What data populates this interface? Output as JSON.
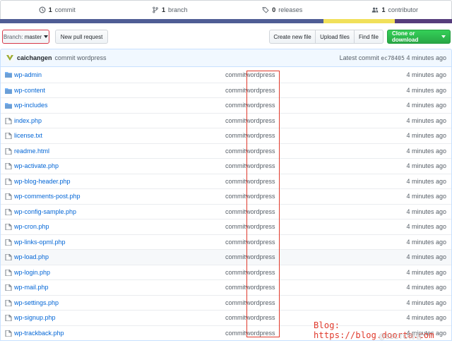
{
  "stats": {
    "commits_count": "1",
    "commits_label": "commit",
    "branches_count": "1",
    "branches_label": "branch",
    "releases_count": "0",
    "releases_label": "releases",
    "contributors_count": "1",
    "contributors_label": "contributor"
  },
  "language_bar_colors": [
    "#4f5d95",
    "#f1e05a",
    "#563d7c"
  ],
  "toolbar": {
    "branch_prefix": "Branch:",
    "branch_name": "master",
    "new_pull_request": "New pull request",
    "create_new_file": "Create new file",
    "upload_files": "Upload files",
    "find_file": "Find file",
    "clone_or_download": "Clone or download"
  },
  "commit_tease": {
    "author": "caichangen",
    "message": "commit wordpress",
    "latest_label": "Latest commit",
    "sha": "ec78405",
    "age": "4 minutes ago"
  },
  "files": [
    {
      "name": "wp-admin",
      "type": "dir",
      "message_a": "commit",
      "message_b": "wordpress",
      "age": "4 minutes ago"
    },
    {
      "name": "wp-content",
      "type": "dir",
      "message_a": "commit",
      "message_b": "wordpress",
      "age": "4 minutes ago"
    },
    {
      "name": "wp-includes",
      "type": "dir",
      "message_a": "commit",
      "message_b": "wordpress",
      "age": "4 minutes ago"
    },
    {
      "name": "index.php",
      "type": "file",
      "message_a": "commit",
      "message_b": "wordpress",
      "age": "4 minutes ago"
    },
    {
      "name": "license.txt",
      "type": "file",
      "message_a": "commit",
      "message_b": "wordpress",
      "age": "4 minutes ago"
    },
    {
      "name": "readme.html",
      "type": "file",
      "message_a": "commit",
      "message_b": "wordpress",
      "age": "4 minutes ago"
    },
    {
      "name": "wp-activate.php",
      "type": "file",
      "message_a": "commit",
      "message_b": "wordpress",
      "age": "4 minutes ago"
    },
    {
      "name": "wp-blog-header.php",
      "type": "file",
      "message_a": "commit",
      "message_b": "wordpress",
      "age": "4 minutes ago"
    },
    {
      "name": "wp-comments-post.php",
      "type": "file",
      "message_a": "commit",
      "message_b": "wordpress",
      "age": "4 minutes ago"
    },
    {
      "name": "wp-config-sample.php",
      "type": "file",
      "message_a": "commit",
      "message_b": "wordpress",
      "age": "4 minutes ago"
    },
    {
      "name": "wp-cron.php",
      "type": "file",
      "message_a": "commit",
      "message_b": "wordpress",
      "age": "4 minutes ago"
    },
    {
      "name": "wp-links-opml.php",
      "type": "file",
      "message_a": "commit",
      "message_b": "wordpress",
      "age": "4 minutes ago"
    },
    {
      "name": "wp-load.php",
      "type": "file",
      "message_a": "commit",
      "message_b": "wordpress",
      "age": "4 minutes ago"
    },
    {
      "name": "wp-login.php",
      "type": "file",
      "message_a": "commit",
      "message_b": "wordpress",
      "age": "4 minutes ago"
    },
    {
      "name": "wp-mail.php",
      "type": "file",
      "message_a": "commit",
      "message_b": "wordpress",
      "age": "4 minutes ago"
    },
    {
      "name": "wp-settings.php",
      "type": "file",
      "message_a": "commit",
      "message_b": "wordpress",
      "age": "4 minutes ago"
    },
    {
      "name": "wp-signup.php",
      "type": "file",
      "message_a": "commit",
      "message_b": "wordpress",
      "age": "4 minutes ago"
    },
    {
      "name": "wp-trackback.php",
      "type": "file",
      "message_a": "commit",
      "message_b": "wordpress",
      "age": "4 minutes ago"
    }
  ],
  "watermark": "Blog: https://blog.doorta.com",
  "watermark_faint": "@51CTO博客"
}
